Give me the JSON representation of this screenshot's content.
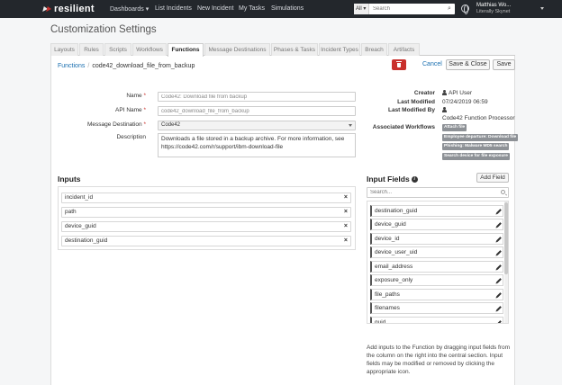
{
  "topbar": {
    "logo": "resilient",
    "nav": [
      "Dashboards ▾",
      "List Incidents",
      "New Incident",
      "My Tasks",
      "Simulations"
    ],
    "search_scope": "All ▾",
    "search_placeholder": "Search",
    "user_name": "Matthias Wo...",
    "user_org": "Literally Skynet"
  },
  "page": {
    "title": "Customization Settings"
  },
  "tabs": [
    "Layouts",
    "Rules",
    "Scripts",
    "Workflows",
    "Functions",
    "Message Destinations",
    "Phases & Tasks",
    "Incident Types",
    "Breach",
    "Artifacts"
  ],
  "breadcrumb": {
    "root": "Functions",
    "current": "code42_download_file_from_backup"
  },
  "actions": {
    "cancel": "Cancel",
    "save_close": "Save & Close",
    "save": "Save"
  },
  "form": {
    "name_label": "Name",
    "name_value": "Code42: Download file from backup",
    "api_label": "API Name",
    "api_value": "code42_download_file_from_backup",
    "dest_label": "Message Destination",
    "dest_value": "Code42",
    "desc_label": "Description",
    "desc_line1": "Downloads a file stored in a backup archive. For more information, see",
    "desc_line2": "https://code42.com/r/support/ibm-download-file",
    "required_mark": "*"
  },
  "meta": {
    "creator_label": "Creator",
    "creator_value": "API User",
    "modified_label": "Last Modified",
    "modified_value": "07/24/2019 06:59",
    "modified_by_label": "Last Modified By",
    "modified_by_value": "Code42 Function Processor",
    "workflows_label": "Associated Workflows",
    "workflows": [
      "Attach file",
      "Employee departure: Download file",
      "Phishing: Malware MD5 search",
      "Search device for file exposure"
    ]
  },
  "inputs": {
    "title": "Inputs",
    "items": [
      "incident_id",
      "path",
      "device_guid",
      "destination_guid"
    ],
    "remove_glyph": "×"
  },
  "input_fields": {
    "title": "Input Fields",
    "info_glyph": "i",
    "add_label": "Add Field",
    "search_placeholder": "Search...",
    "items": [
      "destination_guid",
      "device_guid",
      "device_id",
      "device_user_uid",
      "email_address",
      "exposure_only",
      "file_paths",
      "filenames",
      "guid"
    ],
    "help": "Add inputs to the Function by dragging input fields from the column on the right into the central section. Input fields may be modified or removed by clicking the appropriate icon."
  }
}
